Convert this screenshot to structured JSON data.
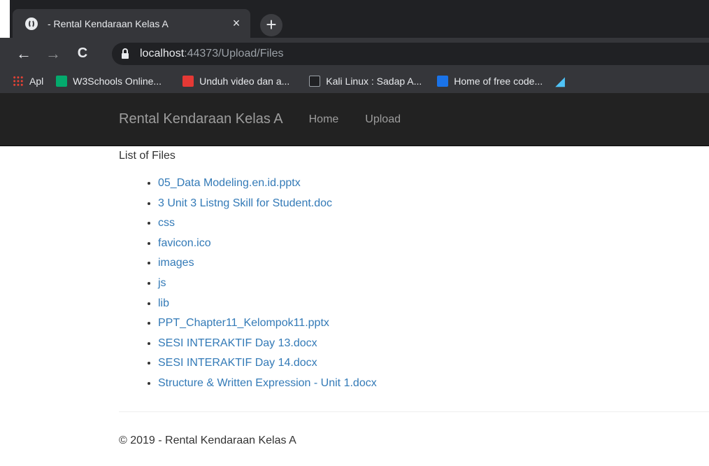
{
  "browser": {
    "tab_title": "- Rental Kendaraan Kelas A",
    "tab_close": "×",
    "new_tab": "+",
    "back": "←",
    "forward": "→",
    "reload": "C",
    "url_host": "localhost",
    "url_path": ":44373/Upload/Files",
    "bookmarks": [
      {
        "label": "Apl",
        "icon": "apps-grid-icon"
      },
      {
        "label": "W3Schools Online...",
        "icon": "w3schools-icon"
      },
      {
        "label": "Unduh video dan a...",
        "icon": "download-icon"
      },
      {
        "label": "Kali Linux : Sadap A...",
        "icon": "terminal-icon"
      },
      {
        "label": "Home of free code...",
        "icon": "code-icon"
      }
    ]
  },
  "navbar": {
    "brand": "Rental Kendaraan Kelas A",
    "links": [
      "Home",
      "Upload"
    ]
  },
  "main": {
    "heading": "List of Files",
    "files": [
      "05_Data Modeling.en.id.pptx",
      "3 Unit 3 Listng Skill for Student.doc",
      "css",
      "favicon.ico",
      "images",
      "js",
      "lib",
      "PPT_Chapter11_Kelompok11.pptx",
      "SESI INTERAKTIF Day 13.docx",
      "SESI INTERAKTIF Day 14.docx",
      "Structure & Written Expression - Unit 1.docx"
    ]
  },
  "footer": {
    "text": "© 2019 - Rental Kendaraan Kelas A"
  },
  "colors": {
    "link": "#337ab7",
    "navbar_bg": "#222222",
    "navbar_text": "#9d9d9d",
    "browser_dark": "#202124",
    "browser_toolbar": "#35363a"
  }
}
